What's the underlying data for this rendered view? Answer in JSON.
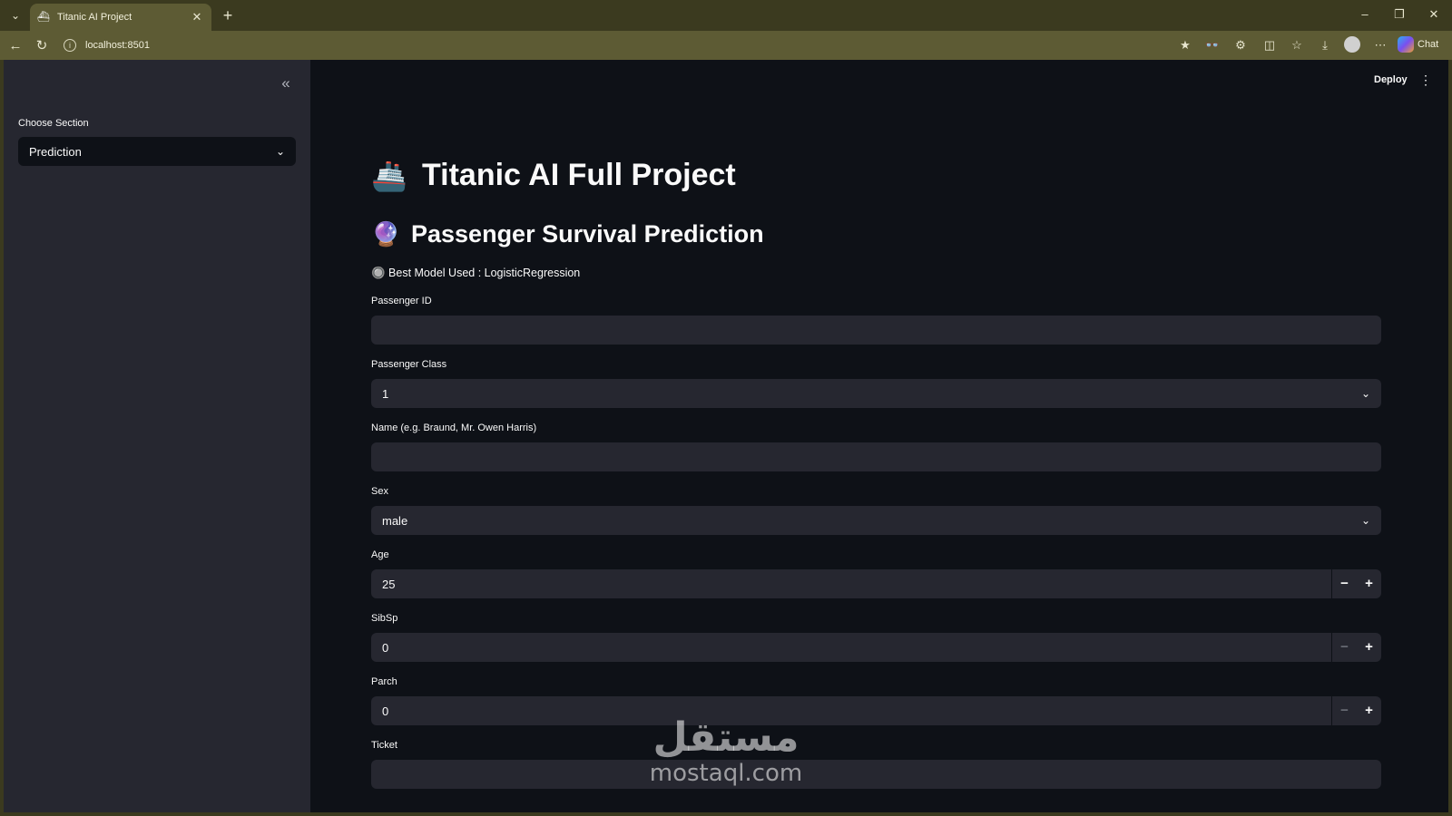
{
  "browser": {
    "tab_title": "Titanic AI Project",
    "url": "localhost:8501",
    "chat_label": "Chat"
  },
  "app": {
    "deploy_label": "Deploy",
    "sidebar": {
      "section_label": "Choose Section",
      "section_value": "Prediction"
    },
    "title": "Titanic AI Full Project",
    "subtitle": "Passenger Survival Prediction",
    "model_info": "🔘 Best Model Used : LogisticRegression",
    "form": {
      "passenger_id": {
        "label": "Passenger ID",
        "value": ""
      },
      "pclass": {
        "label": "Passenger Class",
        "value": "1"
      },
      "name": {
        "label": "Name (e.g. Braund, Mr. Owen Harris)",
        "value": ""
      },
      "sex": {
        "label": "Sex",
        "value": "male"
      },
      "age": {
        "label": "Age",
        "value": "25"
      },
      "sibsp": {
        "label": "SibSp",
        "value": "0"
      },
      "parch": {
        "label": "Parch",
        "value": "0"
      },
      "ticket": {
        "label": "Ticket",
        "value": ""
      }
    }
  },
  "watermark": {
    "arabic": "مستقل",
    "latin": "mostaql.com"
  },
  "icons": {
    "title_icon": "ship-icon",
    "subtitle_icon": "crystal-ball-icon"
  },
  "colors": {
    "app_bg": "#0e1117",
    "sidebar_bg": "#262730",
    "input_bg": "#262730",
    "browser_chrome": "#3b3a1f"
  }
}
